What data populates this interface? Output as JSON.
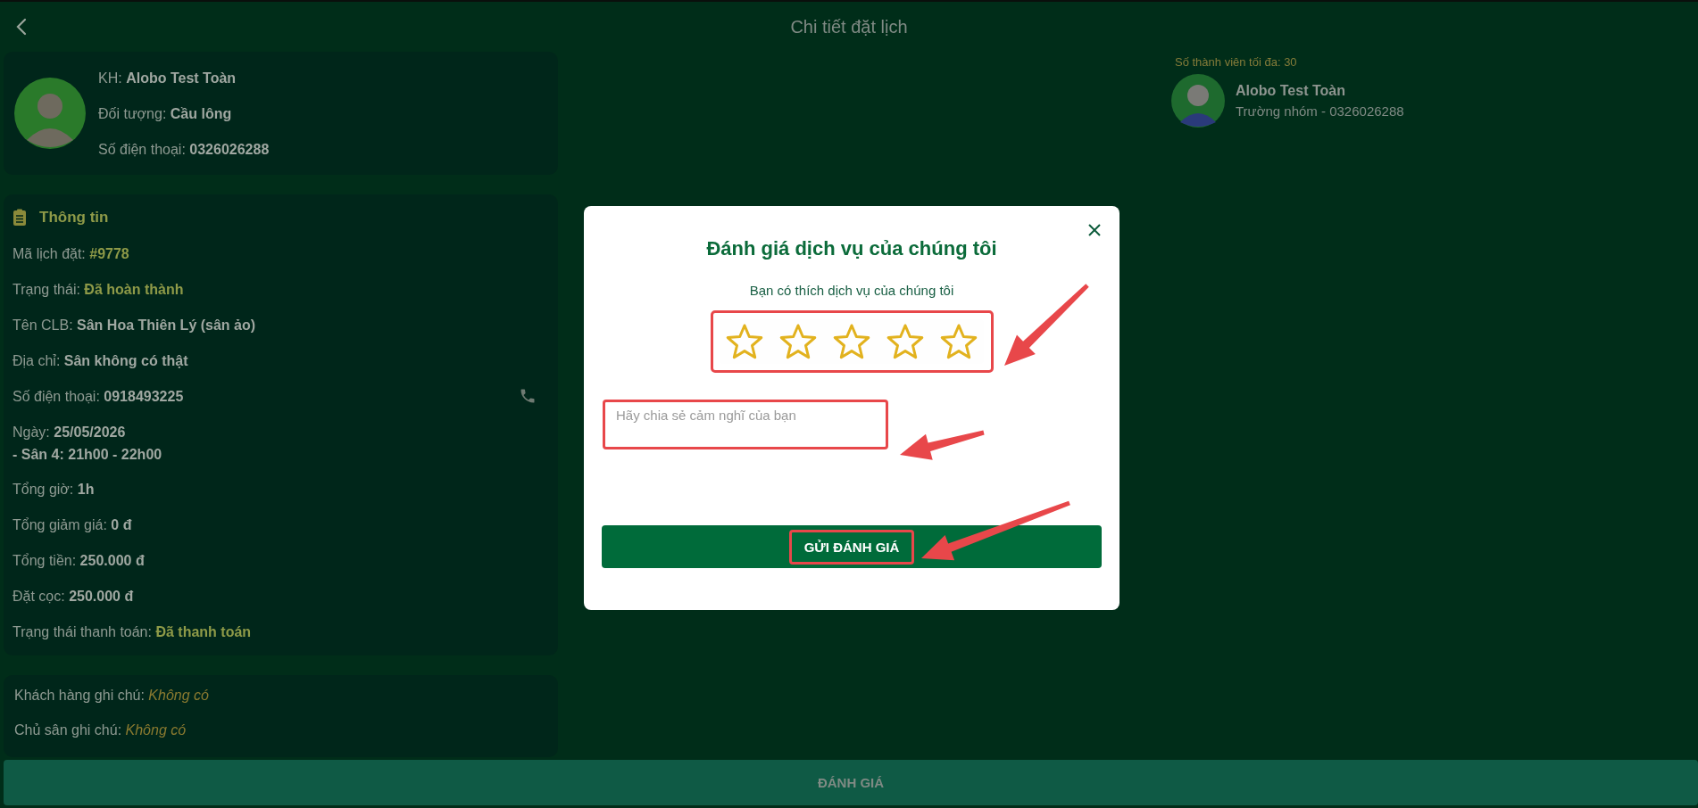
{
  "header": {
    "title": "Chi tiết đặt lịch"
  },
  "customer": {
    "rows": [
      {
        "label": "KH:",
        "value": "Alobo Test Toàn"
      },
      {
        "label": "Đối tượng:",
        "value": "Cầu lông"
      },
      {
        "label": "Số điện thoại:",
        "value": "0326026288"
      }
    ]
  },
  "info": {
    "title": "Thông tin",
    "rows": [
      {
        "kind": "status",
        "label": "Mã lịch đặt:",
        "value": "#9778"
      },
      {
        "kind": "status",
        "label": "Trạng thái:",
        "value": "Đã hoàn thành"
      },
      {
        "kind": "plain",
        "label": "Tên CLB:",
        "value": "Sân Hoa Thiên Lý (sân ảo)"
      },
      {
        "kind": "plain",
        "label": "Địa chỉ:",
        "value": "Sân không có thật"
      },
      {
        "kind": "phone",
        "label": "Số điện thoại:",
        "value": "0918493225"
      },
      {
        "kind": "plain",
        "label": "Ngày:",
        "value": "25/05/2026"
      },
      {
        "kind": "detail",
        "value": " - Sân 4: 21h00 - 22h00"
      },
      {
        "kind": "plain",
        "label": "Tổng giờ:",
        "value": "1h"
      },
      {
        "kind": "plain",
        "label": "Tổng giảm giá:",
        "value": "0 đ"
      },
      {
        "kind": "plain",
        "label": "Tổng tiền:",
        "value": "250.000 đ"
      },
      {
        "kind": "plain",
        "label": "Đặt cọc:",
        "value": "250.000 đ"
      },
      {
        "kind": "status",
        "label": "Trạng thái thanh toán:",
        "value": "Đã thanh toán"
      }
    ]
  },
  "notes": [
    {
      "label": "Khách hàng ghi chú:",
      "value": "Không có"
    },
    {
      "label": "Chủ sân ghi chú:",
      "value": "Không có"
    }
  ],
  "members": {
    "max_label": "Số thành viên tối đa: 30",
    "items": [
      {
        "name": "Alobo Test Toàn",
        "role": "Trường nhóm - 0326026288"
      }
    ]
  },
  "review_button": "ĐÁNH GIÁ",
  "rating_dialog": {
    "title": "Đánh giá dịch vụ của chúng tôi",
    "question": "Bạn có thích dịch vụ của chúng tôi",
    "stars": 0,
    "comment": {
      "placeholder": "Hãy chia sẻ cảm nghĩ của bạn"
    },
    "submit": "GỬI ĐÁNH GIÁ"
  }
}
